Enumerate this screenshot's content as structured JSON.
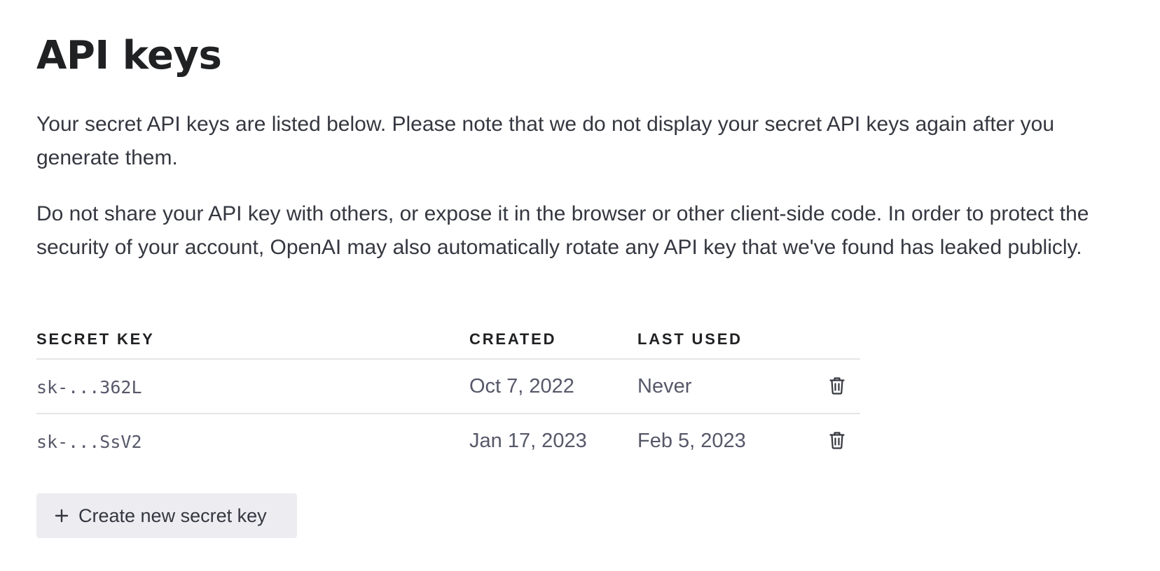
{
  "page": {
    "title": "API keys",
    "intro_text": "Your secret API keys are listed below. Please note that we do not display your secret API keys again after you generate them.",
    "warning_text": "Do not share your API key with others, or expose it in the browser or other client-side code. In order to protect the security of your account, OpenAI may also automatically rotate any API key that we've found has leaked publicly."
  },
  "table": {
    "headers": {
      "secret_key": "SECRET KEY",
      "created": "CREATED",
      "last_used": "LAST USED"
    },
    "rows": [
      {
        "key": "sk-...362L",
        "created": "Oct 7, 2022",
        "last_used": "Never",
        "action_icon": "trash-icon"
      },
      {
        "key": "sk-...SsV2",
        "created": "Jan 17, 2023",
        "last_used": "Feb 5, 2023",
        "action_icon": "trash-icon"
      }
    ]
  },
  "actions": {
    "create_label": "Create new secret key",
    "create_icon": "plus-icon"
  },
  "colors": {
    "heading": "#202123",
    "text": "#353740",
    "muted": "#565869",
    "button_bg": "#ececf1",
    "divider": "#e5e5e8"
  }
}
